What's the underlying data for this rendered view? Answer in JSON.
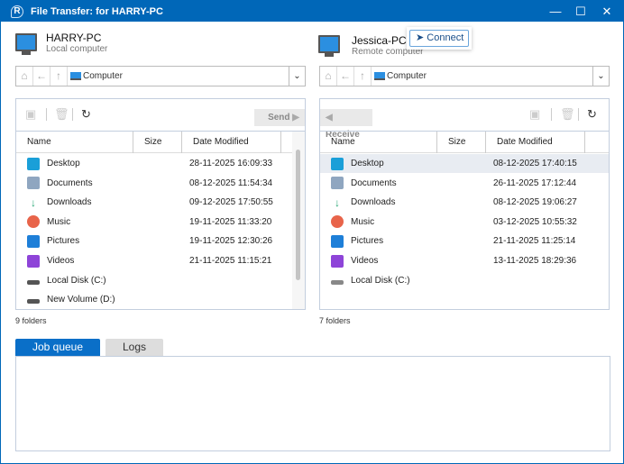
{
  "window": {
    "title": "File Transfer: for HARRY-PC",
    "minimize": "—",
    "maximize": "☐",
    "close": "✕"
  },
  "local": {
    "name": "HARRY-PC",
    "subtitle": "Local computer",
    "path": "Computer",
    "send_label": "Send",
    "status": "9 folders",
    "columns": [
      "Name",
      "Size",
      "Date Modified"
    ],
    "items": [
      {
        "name": "Desktop",
        "date": "28-11-2025 16:09:33",
        "icon": "desktop",
        "color": "#1a9fd8"
      },
      {
        "name": "Documents",
        "date": "08-12-2025 11:54:34",
        "icon": "documents",
        "color": "#8fa6c0"
      },
      {
        "name": "Downloads",
        "date": "09-12-2025 17:50:55",
        "icon": "downloads",
        "color": "#2aa876"
      },
      {
        "name": "Music",
        "date": "19-11-2025 11:33:20",
        "icon": "music",
        "color": "#e8644a"
      },
      {
        "name": "Pictures",
        "date": "19-11-2025 12:30:26",
        "icon": "pictures",
        "color": "#1e7fd8"
      },
      {
        "name": "Videos",
        "date": "21-11-2025 11:15:21",
        "icon": "videos",
        "color": "#8e44d8"
      },
      {
        "name": "Local Disk (C:)",
        "date": "",
        "icon": "drive",
        "color": "#555555"
      },
      {
        "name": "New Volume (D:)",
        "date": "",
        "icon": "drive",
        "color": "#555555"
      }
    ]
  },
  "remote": {
    "name": "Jessica-PC",
    "subtitle": "Remote computer",
    "connect_label": "Connect",
    "path": "Computer",
    "receive_label": "Receive",
    "status": "7 folders",
    "columns": [
      "Name",
      "Size",
      "Date Modified"
    ],
    "items": [
      {
        "name": "Desktop",
        "date": "08-12-2025 17:40:15",
        "icon": "desktop",
        "color": "#1a9fd8",
        "selected": true
      },
      {
        "name": "Documents",
        "date": "26-11-2025 17:12:44",
        "icon": "documents",
        "color": "#8fa6c0"
      },
      {
        "name": "Downloads",
        "date": "08-12-2025 19:06:27",
        "icon": "downloads",
        "color": "#2aa876"
      },
      {
        "name": "Music",
        "date": "03-12-2025 10:55:32",
        "icon": "music",
        "color": "#e8644a"
      },
      {
        "name": "Pictures",
        "date": "21-11-2025 11:25:14",
        "icon": "pictures",
        "color": "#1e7fd8"
      },
      {
        "name": "Videos",
        "date": "13-11-2025 18:29:36",
        "icon": "videos",
        "color": "#8e44d8"
      },
      {
        "name": "Local Disk (C:)",
        "date": "",
        "icon": "drive",
        "color": "#888888"
      }
    ]
  },
  "tabs": [
    {
      "label": "Job queue",
      "active": true
    },
    {
      "label": "Logs",
      "active": false
    }
  ],
  "colors": {
    "accent": "#0067b8"
  }
}
